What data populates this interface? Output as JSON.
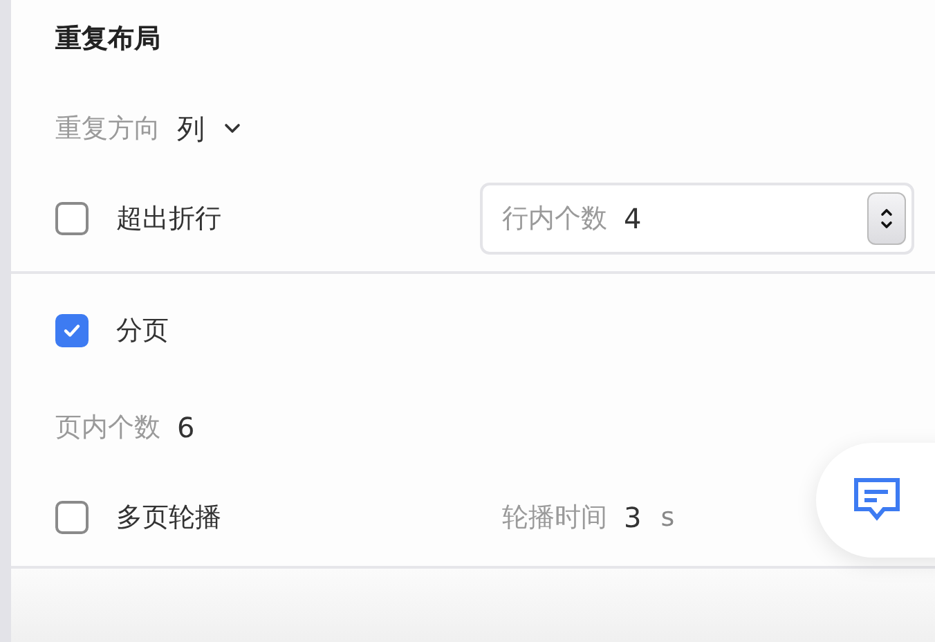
{
  "section": {
    "title": "重复布局"
  },
  "direction": {
    "label": "重复方向",
    "value": "列"
  },
  "wrap": {
    "label": "超出折行",
    "checked": false,
    "count_field": {
      "label": "行内个数",
      "value": "4"
    }
  },
  "paging": {
    "label": "分页",
    "checked": true
  },
  "page_count": {
    "label": "页内个数",
    "value": "6"
  },
  "carousel": {
    "label": "多页轮播",
    "checked": false,
    "interval": {
      "label": "轮播时间",
      "value": "3",
      "unit": "s"
    }
  }
}
